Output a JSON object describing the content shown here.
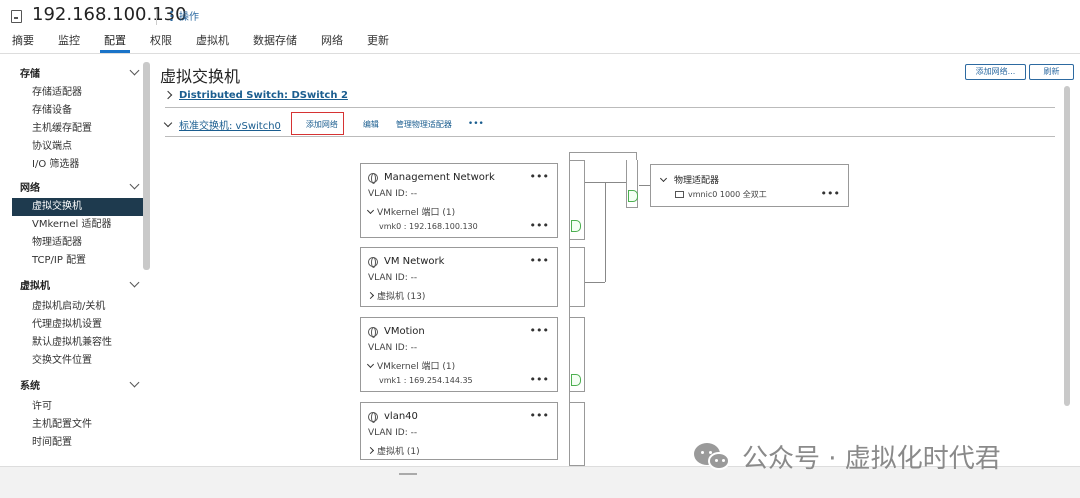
{
  "header": {
    "host_title": "192.168.100.130",
    "actions_label": "操作"
  },
  "tabs": [
    {
      "label": "摘要"
    },
    {
      "label": "监控"
    },
    {
      "label": "配置",
      "active": true
    },
    {
      "label": "权限"
    },
    {
      "label": "虚拟机"
    },
    {
      "label": "数据存储"
    },
    {
      "label": "网络"
    },
    {
      "label": "更新"
    }
  ],
  "sidebar": {
    "groups": [
      {
        "label": "存储",
        "items": [
          "存储适配器",
          "存储设备",
          "主机缓存配置",
          "协议端点",
          "I/O 筛选器"
        ]
      },
      {
        "label": "网络",
        "items": [
          "虚拟交换机",
          "VMkernel 适配器",
          "物理适配器",
          "TCP/IP 配置"
        ]
      },
      {
        "label": "虚拟机",
        "items": [
          "虚拟机启动/关机",
          "代理虚拟机设置",
          "默认虚拟机兼容性",
          "交换文件位置"
        ]
      },
      {
        "label": "系统",
        "items": [
          "许可",
          "主机配置文件",
          "时间配置"
        ]
      }
    ],
    "selected": "虚拟交换机"
  },
  "main": {
    "title": "虚拟交换机",
    "add_network_top": "添加网络...",
    "refresh": "刷新",
    "distributed_switch": "Distributed Switch: DSwitch 2",
    "standard_switch": "标准交换机: vSwitch0",
    "action_add_network": "添加网络",
    "action_edit": "编辑",
    "action_manage_adapters": "管理物理适配器",
    "more": "•••"
  },
  "port_groups": [
    {
      "name": "Management Network",
      "vlan": "VLAN ID: --",
      "sub": "VMkernel 端口 (1)",
      "detail": "vmk0 : 192.168.100.130",
      "expanded": true
    },
    {
      "name": "VM Network",
      "vlan": "VLAN ID: --",
      "sub": "虚拟机 (13)",
      "expanded": false
    },
    {
      "name": "VMotion",
      "vlan": "VLAN ID: --",
      "sub": "VMkernel 端口 (1)",
      "detail": "vmk1 : 169.254.144.35",
      "expanded": true
    },
    {
      "name": "vlan40",
      "vlan": "VLAN ID: --",
      "sub": "虚拟机 (1)",
      "expanded": false
    }
  ],
  "physical_adapters": {
    "title": "物理适配器",
    "nic": "vmnic0 1000 全双工"
  },
  "watermark": "公众号 · 虚拟化时代君",
  "colors": {
    "accent": "#1a73c8",
    "selected_bg": "#1e3a4e",
    "highlight_border": "#d63333",
    "port_green": "#4caf50"
  }
}
